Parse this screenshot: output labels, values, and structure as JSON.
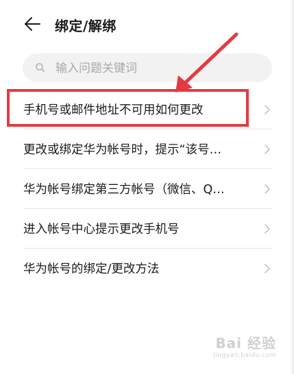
{
  "header": {
    "back_icon": "arrow-left-icon",
    "title": "绑定/解绑"
  },
  "search": {
    "icon": "search-icon",
    "placeholder": "输入问题关键词",
    "value": ""
  },
  "list": {
    "items": [
      {
        "label": "手机号或邮件地址不可用如何更改",
        "icon": "chevron-right-icon",
        "highlighted": true
      },
      {
        "label": "更改或绑定华为帐号时，提示“该号…",
        "icon": "chevron-right-icon"
      },
      {
        "label": "华为帐号绑定第三方帐号（微信、Q…",
        "icon": "chevron-right-icon"
      },
      {
        "label": "进入帐号中心提示更改手机号",
        "icon": "chevron-right-icon"
      },
      {
        "label": "华为帐号的绑定/更改方法",
        "icon": "chevron-right-icon"
      }
    ]
  },
  "annotation": {
    "color": "#e53941"
  },
  "watermark": {
    "main": "Bai 经验",
    "sub": "jingyan.baidu.com"
  }
}
